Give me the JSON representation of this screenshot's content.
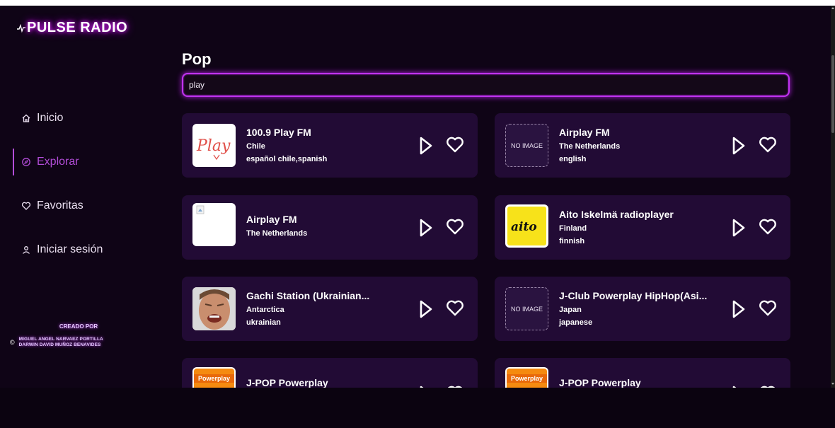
{
  "app": {
    "logo": "PULSE RADIO"
  },
  "nav": {
    "items": [
      {
        "label": "Inicio",
        "icon": "home-icon"
      },
      {
        "label": "Explorar",
        "icon": "compass-icon",
        "active": true
      },
      {
        "label": "Favoritas",
        "icon": "heart-icon"
      },
      {
        "label": "Iniciar sesión",
        "icon": "user-icon"
      }
    ]
  },
  "credits": {
    "title": "CREADO POR",
    "symbol": "©",
    "names": [
      "MIGUEL ANGEL NARVAEZ PORTILLA",
      "DARWIN DAVID MUÑOZ BENAVIDES"
    ]
  },
  "page": {
    "title": "Pop"
  },
  "search": {
    "value": "play"
  },
  "stations": [
    {
      "name": "100.9 Play FM",
      "country": "Chile",
      "tags": "español chile,spanish",
      "thumb": "play-logo"
    },
    {
      "name": "Airplay FM",
      "country": "The Netherlands",
      "tags": "english",
      "thumb": "no-image",
      "thumb_text": "NO IMAGE"
    },
    {
      "name": "Airplay FM",
      "country": "The Netherlands",
      "tags": "",
      "thumb": "broken-image"
    },
    {
      "name": "Aito Iskelmä radioplayer",
      "country": "Finland",
      "tags": "finnish",
      "thumb": "aito-logo",
      "thumb_text": "aito"
    },
    {
      "name": "Gachi Station (Ukrainian...",
      "country": "Antarctica",
      "tags": "ukrainian",
      "thumb": "face-photo"
    },
    {
      "name": "J-Club Powerplay HipHop(Asi...",
      "country": "Japan",
      "tags": "japanese",
      "thumb": "no-image",
      "thumb_text": "NO IMAGE"
    },
    {
      "name": "J-POP Powerplay",
      "country": "",
      "tags": "",
      "thumb": "powerplay-logo",
      "thumb_text": "Powerplay"
    },
    {
      "name": "J-POP Powerplay",
      "country": "",
      "tags": "",
      "thumb": "powerplay-logo",
      "thumb_text": "Powerplay"
    }
  ],
  "colors": {
    "accent": "#c033f0",
    "card": "#220b35",
    "active": "#b34dd9"
  }
}
